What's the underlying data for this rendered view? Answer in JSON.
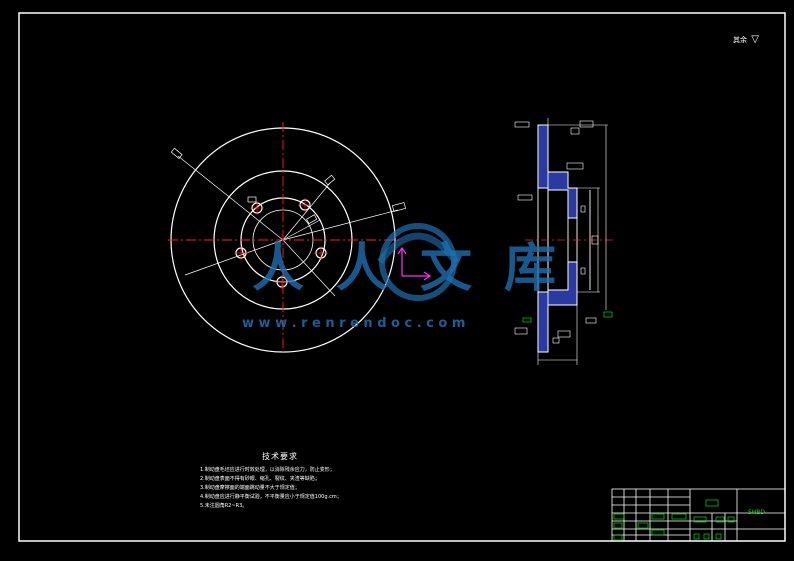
{
  "roughness": {
    "label": "其余",
    "symbol": "▽"
  },
  "tech_requirements": {
    "title": "技术要求",
    "items": [
      "1.制动盘毛坯应进行时效处理，以消除残余应力，防止变形；",
      "2.制动盘表面不得有砂眼、缩孔、裂纹、夹渣等缺陷；",
      "3.制动盘摩擦面的端面跳动量不大于规定值；",
      "4.制动盘应进行静平衡试验，不平衡量应小于规定值100g.cm；",
      "5.未注圆角R2~R3。"
    ]
  },
  "watermark": {
    "text": "人人文库",
    "url": "w w w . r e n r e n d o c . c o m"
  },
  "title_block": {
    "code": "SHBD"
  },
  "colors": {
    "outline": "#ffffff",
    "centerline": "#ff2020",
    "section_fill": "#2a3aa0",
    "dimension": "#ffffff",
    "annotation": "#00e000",
    "axis": "#ff30ff",
    "watermark": "#1f6fb0"
  }
}
